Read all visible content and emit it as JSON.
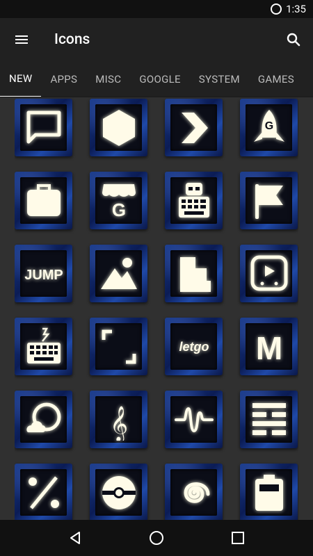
{
  "status": {
    "time": "1:35"
  },
  "toolbar": {
    "title": "Icons"
  },
  "tabs": [
    {
      "label": "NEW",
      "active": true
    },
    {
      "label": "APPS"
    },
    {
      "label": "MISC"
    },
    {
      "label": "GOOGLE"
    },
    {
      "label": "SYSTEM"
    },
    {
      "label": "GAMES"
    }
  ],
  "icons": [
    {
      "name": "chat-icon"
    },
    {
      "name": "hexagon-icon"
    },
    {
      "name": "chevron-right-icon"
    },
    {
      "name": "rocket-g-icon"
    },
    {
      "name": "briefcase-icon"
    },
    {
      "name": "google-store-icon"
    },
    {
      "name": "robot-keyboard-icon"
    },
    {
      "name": "flag-icon"
    },
    {
      "name": "jump-icon",
      "text": "JUMP"
    },
    {
      "name": "mountains-icon"
    },
    {
      "name": "buildings-icon"
    },
    {
      "name": "tv-video-icon"
    },
    {
      "name": "keyboard-icon"
    },
    {
      "name": "crop-frame-icon"
    },
    {
      "name": "letgo-icon",
      "text": "letgo"
    },
    {
      "name": "m-logo-icon",
      "text": "M"
    },
    {
      "name": "weather-icon"
    },
    {
      "name": "treble-clef-icon",
      "text": "𝄞"
    },
    {
      "name": "waveform-icon"
    },
    {
      "name": "hexagram-icon"
    },
    {
      "name": "percent-icon"
    },
    {
      "name": "pokeball-icon"
    },
    {
      "name": "spiral-icon"
    },
    {
      "name": "clipboard-icon"
    }
  ]
}
